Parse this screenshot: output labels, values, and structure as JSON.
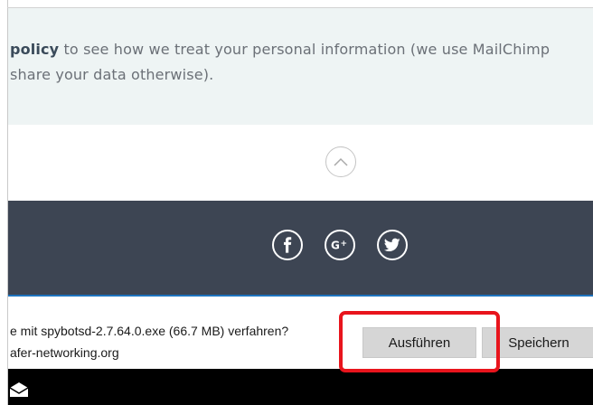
{
  "privacy": {
    "policy_word": "policy",
    "line1_rest": " to see how we treat your personal information (we use MailChimp",
    "line2": "share your data otherwise)."
  },
  "scroll_top": {
    "icon": "chevron-up-icon"
  },
  "footer": {
    "social": [
      {
        "name": "facebook",
        "glyph": "f"
      },
      {
        "name": "google-plus",
        "glyph": "G+"
      },
      {
        "name": "twitter",
        "glyph": "twitter-bird"
      }
    ]
  },
  "download_bar": {
    "question": "e mit spybotsd-2.7.64.0.exe (66.7 MB) verfahren?",
    "source": "afer-networking.org",
    "run_label": "Ausführen",
    "save_label": "Speichern"
  },
  "colors": {
    "footer_bg": "#3d4553",
    "privacy_bg": "#eef4f4",
    "highlight": "#e8141c",
    "bar_accent": "#1e73be"
  }
}
